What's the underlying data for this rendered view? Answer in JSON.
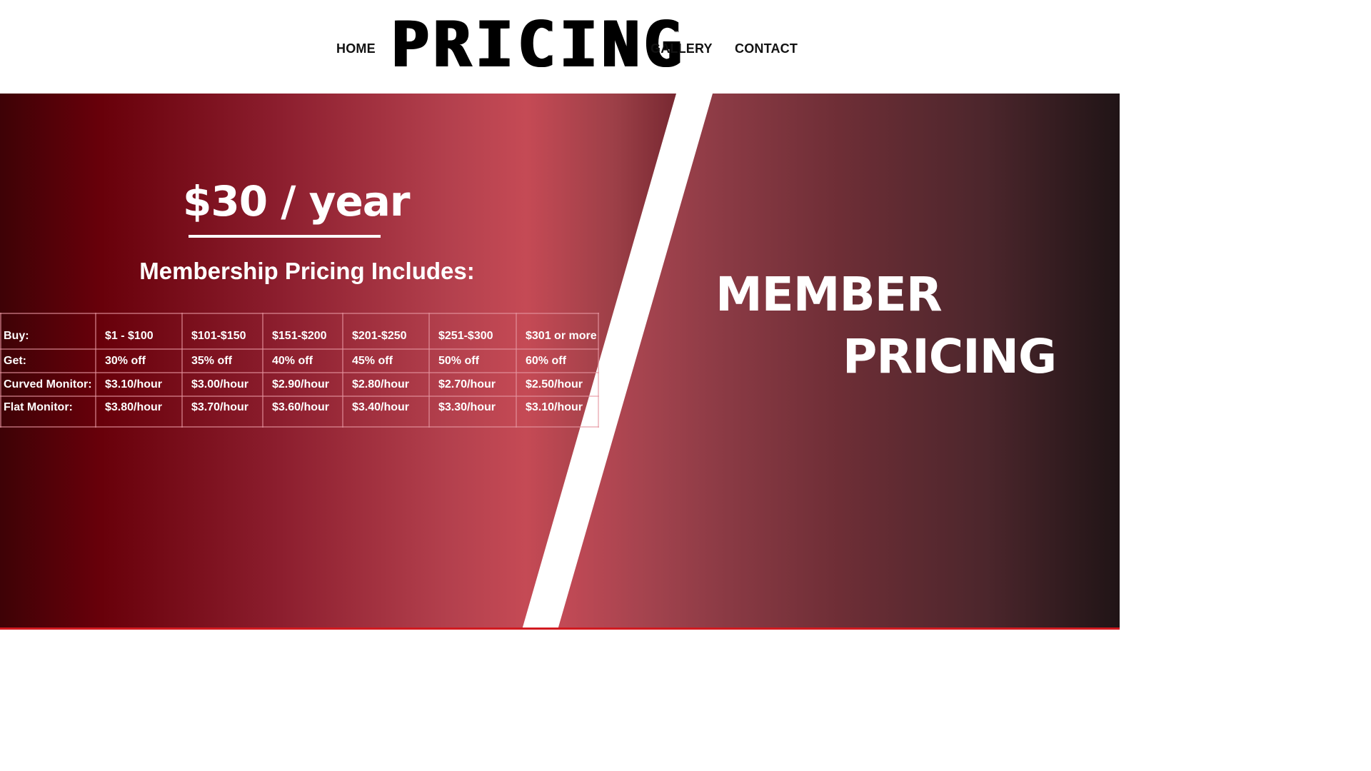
{
  "header": {
    "nav": {
      "home": "HOME",
      "gallery": "GALLERY",
      "contact": "CONTACT"
    },
    "logo_text": "PRICING"
  },
  "left_panel": {
    "price": "$30 / year",
    "subtitle": "Membership  Pricing Includes:",
    "table": {
      "rows": [
        {
          "label": "Buy:",
          "cells": [
            "$1 - $100",
            "$101-$150",
            "$151-$200",
            "$201-$250",
            "$251-$300",
            "$301 or more"
          ]
        },
        {
          "label": "Get:",
          "cells": [
            "30% off",
            "35% off",
            "40% off",
            "45% off",
            "50% off",
            "60% off"
          ]
        },
        {
          "label": "Curved Monitor:",
          "cells": [
            "$3.10/hour",
            "$3.00/hour",
            "$2.90/hour",
            "$2.80/hour",
            "$2.70/hour",
            "$2.50/hour"
          ]
        },
        {
          "label": "Flat Monitor:",
          "cells": [
            "$3.80/hour",
            "$3.70/hour",
            "$3.60/hour",
            "$3.40/hour",
            "$3.30/hour",
            "$3.10/hour"
          ]
        }
      ]
    }
  },
  "right_panel": {
    "line1": "MEMBER",
    "line2": "PRICING"
  },
  "colors": {
    "accent_dark": "#68000a",
    "accent_light": "#c54a55",
    "bottom_line": "#d21a20"
  }
}
